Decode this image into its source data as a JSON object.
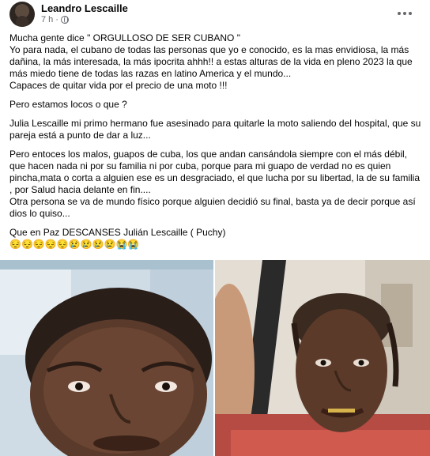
{
  "header": {
    "author_name": "Leandro Lescaille",
    "timestamp": "7 h",
    "separator": "·",
    "privacy_icon": "globe-icon",
    "more_icon": "more-options-icon"
  },
  "post": {
    "paragraphs": [
      "Mucha gente dice \" ORGULLOSO DE SER CUBANO \"",
      "Yo para nada, el cubano de todas las personas que yo e conocido, es la mas envidiosa, la más dañina, la más interesada, la más ipocrita ahhh!! a estas alturas de la vida en pleno 2023 la que más miedo tiene de todas las razas en latino America y el mundo...",
      "Capaces de quitar vida por el precio  de una moto !!!",
      "Pero estamos locos o que ?",
      "Julia Lescaille mi primo hermano fue asesinado para quitarle la moto saliendo del hospital, que su pareja está a punto de dar a luz...",
      "Pero entoces los malos, guapos de cuba, los que andan cansándola siempre con el más débil, que hacen nada ni por su familia ni por cuba, porque para mi guapo de verdad no es quien pincha,mata o corta a alguien ese es un desgraciado, el que lucha por su libertad, la de su familia , por Salud hacia delante en fin....",
      "Otra persona se va de mundo físico porque alguien decidió su final, basta ya de decir porque así dios lo quiso...",
      "Que en Paz DESCANSES Julián Lescaille  ( Puchy)",
      "😔😔😔😔😔😢😢😢😢😭😭"
    ]
  },
  "photos": {
    "photo1_label": "photo-man-close-up",
    "photo2_label": "photo-man-with-braids"
  }
}
